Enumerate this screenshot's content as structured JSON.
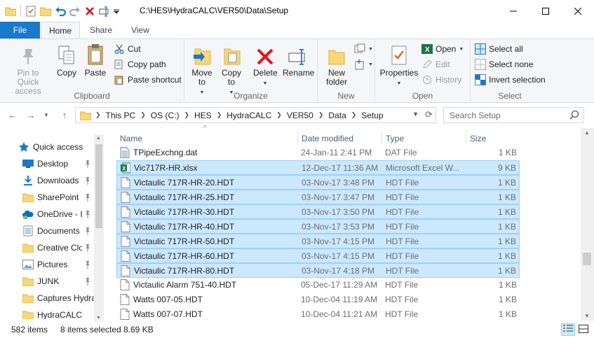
{
  "window": {
    "title": "C:\\HES\\HydraCALC\\VER50\\Data\\Setup"
  },
  "ribbon_tabs": [
    "File",
    "Home",
    "Share",
    "View"
  ],
  "ribbon": {
    "clipboard": {
      "label": "Clipboard",
      "pin": "Pin to Quick access",
      "copy": "Copy",
      "paste": "Paste",
      "cut": "Cut",
      "copy_path": "Copy path",
      "paste_shortcut": "Paste shortcut"
    },
    "organize": {
      "label": "Organize",
      "move_to": "Move to",
      "copy_to": "Copy to",
      "delete": "Delete",
      "rename": "Rename"
    },
    "new": {
      "label": "New",
      "new_folder": "New folder"
    },
    "open": {
      "label": "Open",
      "properties": "Properties",
      "open": "Open",
      "edit": "Edit",
      "history": "History"
    },
    "select": {
      "label": "Select",
      "select_all": "Select all",
      "select_none": "Select none",
      "invert": "Invert selection"
    }
  },
  "address": {
    "crumbs": [
      "This PC",
      "OS (C:)",
      "HES",
      "HydraCALC",
      "VER50",
      "Data",
      "Setup"
    ],
    "search_placeholder": "Search Setup"
  },
  "nav_pane": [
    {
      "label": "Quick access",
      "icon": "star-icon",
      "pinned": false
    },
    {
      "label": "Desktop",
      "icon": "desktop-icon",
      "pinned": true
    },
    {
      "label": "Downloads",
      "icon": "download-icon",
      "pinned": true
    },
    {
      "label": "SharePoint",
      "icon": "folder-icon",
      "pinned": true
    },
    {
      "label": "OneDrive - I",
      "icon": "onedrive-icon",
      "pinned": true
    },
    {
      "label": "Documents",
      "icon": "documents-icon",
      "pinned": true
    },
    {
      "label": "Creative Clo",
      "icon": "folder-icon",
      "pinned": true
    },
    {
      "label": "Pictures",
      "icon": "pictures-icon",
      "pinned": true
    },
    {
      "label": "JUNK",
      "icon": "folder-icon",
      "pinned": true
    },
    {
      "label": "Captures Hydra",
      "icon": "folder-icon",
      "pinned": false
    },
    {
      "label": "HydraCALC",
      "icon": "folder-icon",
      "pinned": false
    }
  ],
  "columns": {
    "name": "Name",
    "date": "Date modified",
    "type": "Type",
    "size": "Size"
  },
  "files": [
    {
      "name": "TPipeExchng.dat",
      "date": "24-Jan-11 2:41 PM",
      "type": "DAT File",
      "size": "1 KB",
      "icon": "dat-file-icon",
      "selected": false
    },
    {
      "name": "Vic717R-HR.xlsx",
      "date": "12-Dec-17 11:36 AM",
      "type": "Microsoft Excel W...",
      "size": "9 KB",
      "icon": "excel-file-icon",
      "selected": true
    },
    {
      "name": "Victaulic 717R-HR-20.HDT",
      "date": "03-Nov-17 3:48 PM",
      "type": "HDT File",
      "size": "1 KB",
      "icon": "file-icon",
      "selected": true
    },
    {
      "name": "Victaulic 717R-HR-25.HDT",
      "date": "03-Nov-17 3:47 PM",
      "type": "HDT File",
      "size": "1 KB",
      "icon": "file-icon",
      "selected": true
    },
    {
      "name": "Victaulic 717R-HR-30.HDT",
      "date": "03-Nov-17 3:50 PM",
      "type": "HDT File",
      "size": "1 KB",
      "icon": "file-icon",
      "selected": true
    },
    {
      "name": "Victaulic 717R-HR-40.HDT",
      "date": "03-Nov-17 3:53 PM",
      "type": "HDT File",
      "size": "1 KB",
      "icon": "file-icon",
      "selected": true
    },
    {
      "name": "Victaulic 717R-HR-50.HDT",
      "date": "03-Nov-17 4:15 PM",
      "type": "HDT File",
      "size": "1 KB",
      "icon": "file-icon",
      "selected": true
    },
    {
      "name": "Victaulic 717R-HR-60.HDT",
      "date": "03-Nov-17 4:15 PM",
      "type": "HDT File",
      "size": "1 KB",
      "icon": "file-icon",
      "selected": true
    },
    {
      "name": "Victaulic 717R-HR-80.HDT",
      "date": "03-Nov-17 4:18 PM",
      "type": "HDT File",
      "size": "1 KB",
      "icon": "file-icon",
      "selected": true
    },
    {
      "name": "Victaulic Alarm 751-40.HDT",
      "date": "05-Dec-17 11:29 AM",
      "type": "HDT File",
      "size": "1 KB",
      "icon": "file-icon",
      "selected": false
    },
    {
      "name": "Watts 007-05.HDT",
      "date": "10-Dec-04 11:19 AM",
      "type": "HDT File",
      "size": "1 KB",
      "icon": "file-icon",
      "selected": false
    },
    {
      "name": "Watts 007-07.HDT",
      "date": "10-Dec-04 11:21 AM",
      "type": "HDT File",
      "size": "1 KB",
      "icon": "file-icon",
      "selected": false
    }
  ],
  "status": {
    "items": "582 items",
    "selected": "8 items selected",
    "size": "8.69 KB"
  },
  "colors": {
    "accent": "#1979ca",
    "selection_bg": "#cce8ff",
    "selection_border": "#99d1ff",
    "folder": "#f8d775",
    "delete_red": "#e81123"
  }
}
